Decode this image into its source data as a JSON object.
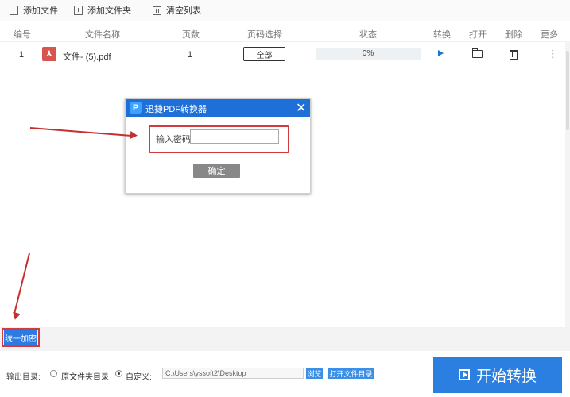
{
  "toolbar": {
    "add_file": "添加文件",
    "add_folder": "添加文件夹",
    "clear_list": "清空列表"
  },
  "table": {
    "headers": {
      "index": "编号",
      "name": "文件名称",
      "pages": "页数",
      "page_select": "页码选择",
      "status": "状态",
      "convert": "转换",
      "open": "打开",
      "delete": "删除",
      "more": "更多"
    },
    "rows": [
      {
        "index": "1",
        "icon": "pdf-icon",
        "name": "文件- (5).pdf",
        "pages": "1",
        "page_select": "全部",
        "progress": "0%",
        "progress_fraction": 0
      }
    ]
  },
  "dialog": {
    "title": "迅捷PDF转换器",
    "logo_letter": "P",
    "close": "✕",
    "password_label": "输入密码",
    "password_value": "",
    "ok_button": "确定"
  },
  "bottom": {
    "encrypt_all": "统一加密",
    "output_label": "输出目录:",
    "option_source": "原文件夹目录",
    "option_custom": "自定义:",
    "selected_option": "custom",
    "path": "C:\\Users\\yssoft2\\Desktop",
    "browse": "浏览",
    "open_dir": "打开文件目录",
    "start": "开始转换"
  },
  "colors": {
    "accent": "#2a7fe0",
    "title_bar": "#1e6fd8",
    "highlight": "#d23b3b",
    "pdf_icon": "#d9534f"
  }
}
